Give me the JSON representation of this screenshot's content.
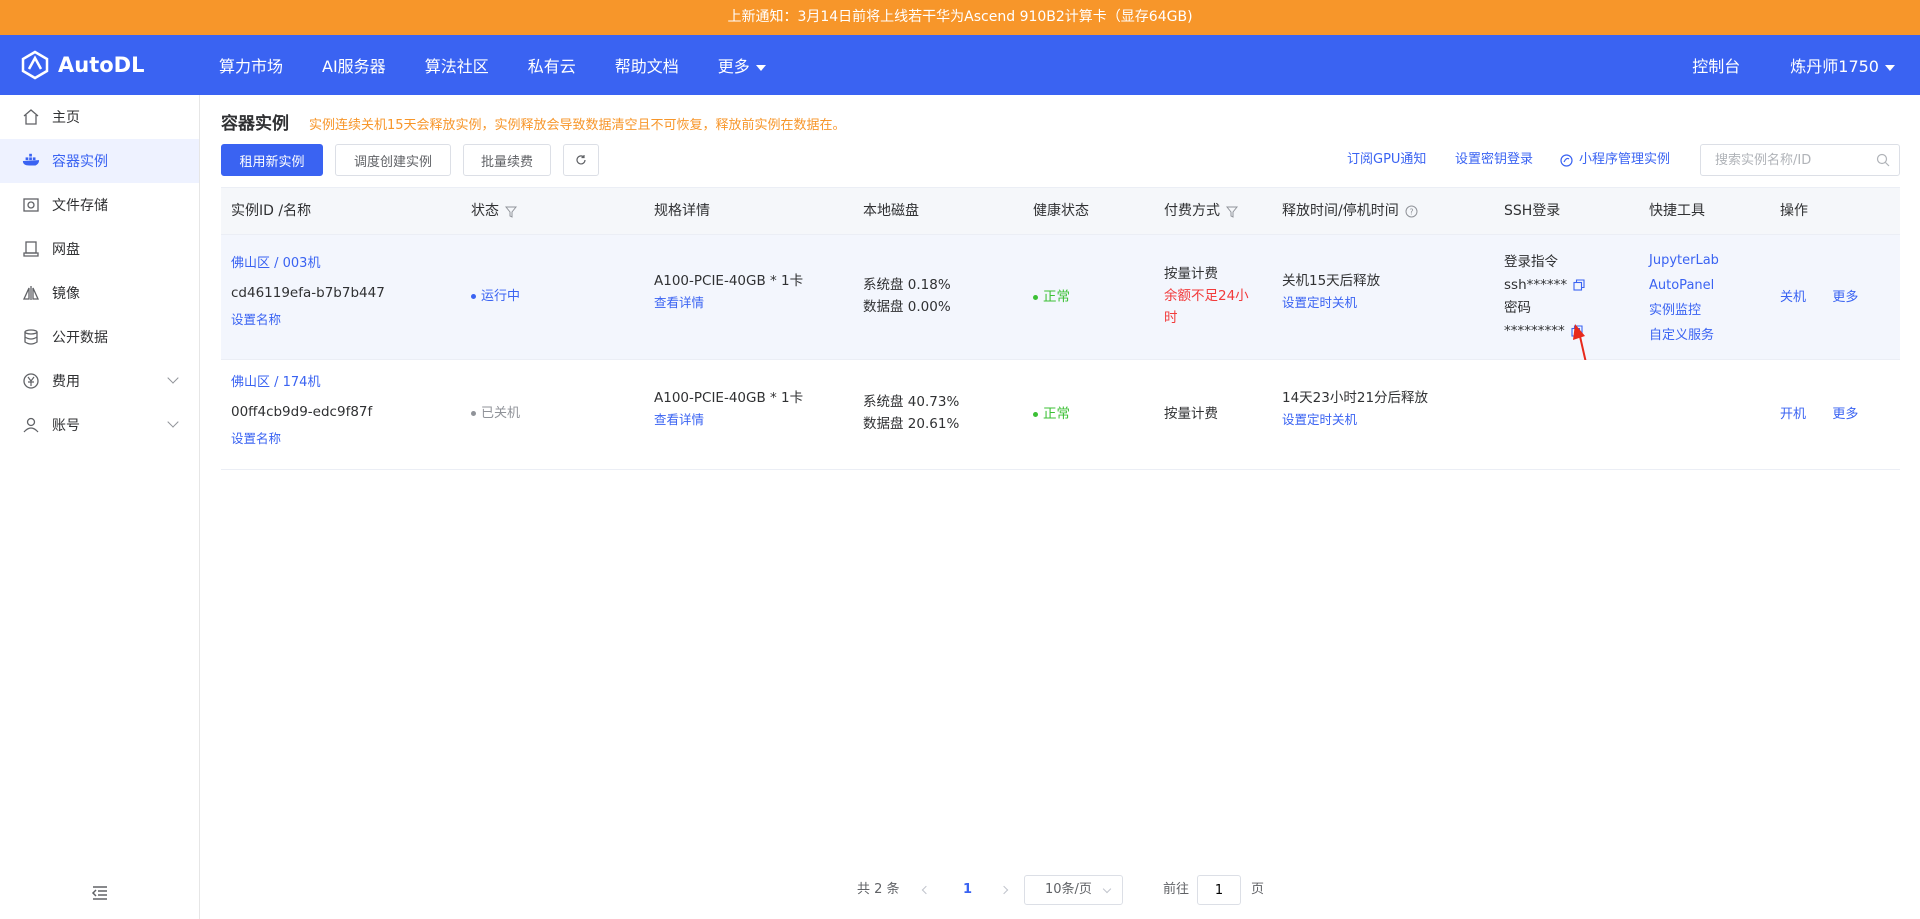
{
  "notice": "上新通知：3月14日前将上线若干华为Ascend 910B2计算卡（显存64GB)",
  "brand": "AutoDL",
  "nav": {
    "links": [
      "算力市场",
      "AI服务器",
      "算法社区",
      "私有云",
      "帮助文档",
      "更多"
    ],
    "console": "控制台",
    "user": "炼丹师1750"
  },
  "sidebar": {
    "items": [
      {
        "label": "主页",
        "icon": "home-icon"
      },
      {
        "label": "容器实例",
        "icon": "container-icon"
      },
      {
        "label": "文件存储",
        "icon": "storage-icon"
      },
      {
        "label": "网盘",
        "icon": "netdisk-icon"
      },
      {
        "label": "镜像",
        "icon": "image-icon"
      },
      {
        "label": "公开数据",
        "icon": "database-icon"
      },
      {
        "label": "费用",
        "icon": "yen-icon"
      },
      {
        "label": "账号",
        "icon": "user-icon"
      }
    ]
  },
  "page": {
    "title": "容器实例",
    "warning": "实例连续关机15天会释放实例，实例释放会导致数据清空且不可恢复，释放前实例在数据在。"
  },
  "toolbar": {
    "rent_new": "租用新实例",
    "schedule_create": "调度创建实例",
    "batch_renew": "批量续费",
    "subscribe_gpu": "订阅GPU通知",
    "set_key_login": "设置密钥登录",
    "miniprogram": "小程序管理实例",
    "search_placeholder": "搜索实例名称/ID"
  },
  "table": {
    "headers": {
      "id_name": "实例ID /名称",
      "status": "状态",
      "spec": "规格详情",
      "disk": "本地磁盘",
      "health": "健康状态",
      "billing": "付费方式",
      "release": "释放时间/停机时间",
      "ssh": "SSH登录",
      "tools": "快捷工具",
      "actions": "操作"
    },
    "rows": [
      {
        "region": "佛山区 / 003机",
        "id": "cd46119efa-b7b7b447",
        "set_name": "设置名称",
        "status": "运行中",
        "spec": "A100-PCIE-40GB * 1卡",
        "view_detail": "查看详情",
        "sys_disk": "系统盘 0.18%",
        "data_disk": "数据盘 0.00%",
        "health": "正常",
        "billing": "按量计费",
        "billing_warn": "余额不足24小时",
        "release": "关机15天后释放",
        "timed_shutdown": "设置定时关机",
        "ssh_cmd_label": "登录指令",
        "ssh_cmd": "ssh******",
        "pwd_label": "密码",
        "pwd": "*********",
        "tools": [
          "JupyterLab",
          "AutoPanel",
          "实例监控",
          "自定义服务"
        ],
        "action_primary": "关机",
        "action_more": "更多"
      },
      {
        "region": "佛山区 / 174机",
        "id": "00ff4cb9d9-edc9f87f",
        "set_name": "设置名称",
        "status": "已关机",
        "spec": "A100-PCIE-40GB * 1卡",
        "view_detail": "查看详情",
        "sys_disk": "系统盘 40.73%",
        "data_disk": "数据盘 20.61%",
        "health": "正常",
        "billing": "按量计费",
        "release": "14天23小时21分后释放",
        "timed_shutdown": "设置定时关机",
        "action_primary": "开机",
        "action_more": "更多"
      }
    ]
  },
  "pager": {
    "total": "共 2 条",
    "current": "1",
    "page_size": "10条/页",
    "goto": "前往",
    "goto_value": "1",
    "page_unit": "页"
  },
  "colors": {
    "brand": "#3a63f2",
    "notice": "#f7962a",
    "ok": "#3cc035",
    "danger": "#f23b3b"
  }
}
